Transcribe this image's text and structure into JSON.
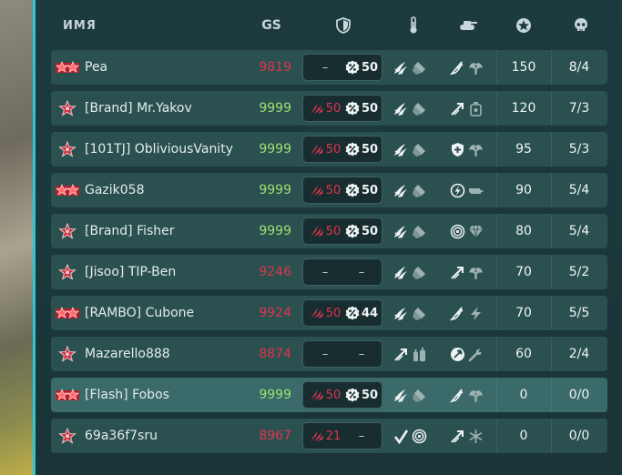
{
  "header": {
    "name_label": "ИМЯ",
    "gs_label": "GS",
    "icons": [
      "shield-icon",
      "thermometer-icon",
      "tank-icon",
      "sheriff-star-icon",
      "skull-icon"
    ]
  },
  "colors": {
    "accent": "#2ec5d8",
    "gs_high": "#9fe070",
    "gs_low": "#e0344c",
    "row": "#2b5050",
    "row_highlight": "#3b6a6a"
  },
  "rows": [
    {
      "rank_icon": "double-rank-icon",
      "name": "Pea",
      "gs": "9819",
      "gs_color": "red",
      "m_left": "–",
      "m_left_icon": false,
      "m_right": "50",
      "m_right_icon": true,
      "g1": [
        "wing-boost-icon",
        "ammo-icon"
      ],
      "g2": [
        "wing-icon",
        "angel-icon"
      ],
      "a": "150",
      "b": "8/4",
      "highlight": false
    },
    {
      "rank_icon": "single-rank-icon",
      "name": "[Brand] Mr.Yakov",
      "gs": "9999",
      "gs_color": "green",
      "m_left": "50",
      "m_left_icon": true,
      "m_right": "50",
      "m_right_icon": true,
      "g1": [
        "wing-boost-icon",
        "ammo-icon"
      ],
      "g2": [
        "arrow-icon",
        "timer-icon"
      ],
      "a": "120",
      "b": "7/3",
      "highlight": false
    },
    {
      "rank_icon": "single-rank-icon",
      "name": "[101TJ] ObliviousVanity",
      "gs": "9999",
      "gs_color": "green",
      "m_left": "50",
      "m_left_icon": true,
      "m_right": "50",
      "m_right_icon": true,
      "g1": [
        "wing-boost-icon",
        "ammo-icon"
      ],
      "g2": [
        "shield-plus-icon",
        "angel-icon"
      ],
      "a": "95",
      "b": "5/3",
      "highlight": false
    },
    {
      "rank_icon": "double-rank-icon",
      "name": "Gazik058",
      "gs": "9999",
      "gs_color": "green",
      "m_left": "50",
      "m_left_icon": true,
      "m_right": "50",
      "m_right_icon": true,
      "g1": [
        "wing-boost-icon",
        "ammo-icon"
      ],
      "g2": [
        "lightning-circle-icon",
        "hand-icon"
      ],
      "a": "90",
      "b": "5/4",
      "highlight": false
    },
    {
      "rank_icon": "single-rank-icon",
      "name": "[Brand] Fisher",
      "gs": "9999",
      "gs_color": "green",
      "m_left": "50",
      "m_left_icon": true,
      "m_right": "50",
      "m_right_icon": true,
      "g1": [
        "wing-boost-icon",
        "ammo-icon"
      ],
      "g2": [
        "target-icon",
        "diamond-icon"
      ],
      "a": "80",
      "b": "5/4",
      "highlight": false
    },
    {
      "rank_icon": "single-rank-icon",
      "name": "[Jisoo] TIP-Ben",
      "gs": "9246",
      "gs_color": "red",
      "m_left": "–",
      "m_left_icon": false,
      "m_right": "–",
      "m_right_icon": false,
      "g1": [
        "wing-boost-icon",
        "ammo-icon"
      ],
      "g2": [
        "arrow-icon",
        "angel-icon"
      ],
      "a": "70",
      "b": "5/2",
      "highlight": false
    },
    {
      "rank_icon": "double-rank-icon",
      "name": "[RAMBO] Cubone",
      "gs": "9924",
      "gs_color": "red",
      "m_left": "50",
      "m_left_icon": true,
      "m_right": "44",
      "m_right_icon": true,
      "g1": [
        "wing-boost-icon",
        "ammo-icon"
      ],
      "g2": [
        "wing-icon",
        "lightning-icon"
      ],
      "a": "70",
      "b": "5/5",
      "highlight": false
    },
    {
      "rank_icon": "single-rank-icon",
      "name": "Mazarello888",
      "gs": "8874",
      "gs_color": "red",
      "m_left": "–",
      "m_left_icon": false,
      "m_right": "–",
      "m_right_icon": false,
      "g1": [
        "arrow-icon",
        "bottles-icon"
      ],
      "g2": [
        "repair-circle-icon",
        "wrench-icon"
      ],
      "a": "60",
      "b": "2/4",
      "highlight": false
    },
    {
      "rank_icon": "double-rank-icon",
      "name": "[Flash] Fobos",
      "gs": "9999",
      "gs_color": "green",
      "m_left": "50",
      "m_left_icon": true,
      "m_right": "50",
      "m_right_icon": true,
      "g1": [
        "wing-boost-icon",
        "ammo-icon"
      ],
      "g2": [
        "wing-icon",
        "angel-icon"
      ],
      "a": "0",
      "b": "0/0",
      "highlight": true
    },
    {
      "rank_icon": "single-rank-icon",
      "name": "69a36f7sru",
      "gs": "8967",
      "gs_color": "red",
      "m_left": "21",
      "m_left_icon": true,
      "m_right": "–",
      "m_right_icon": false,
      "g1": [
        "check-icon",
        "target-icon"
      ],
      "g2": [
        "arrow-icon",
        "snowflake-icon"
      ],
      "a": "0",
      "b": "0/0",
      "highlight": false
    }
  ]
}
